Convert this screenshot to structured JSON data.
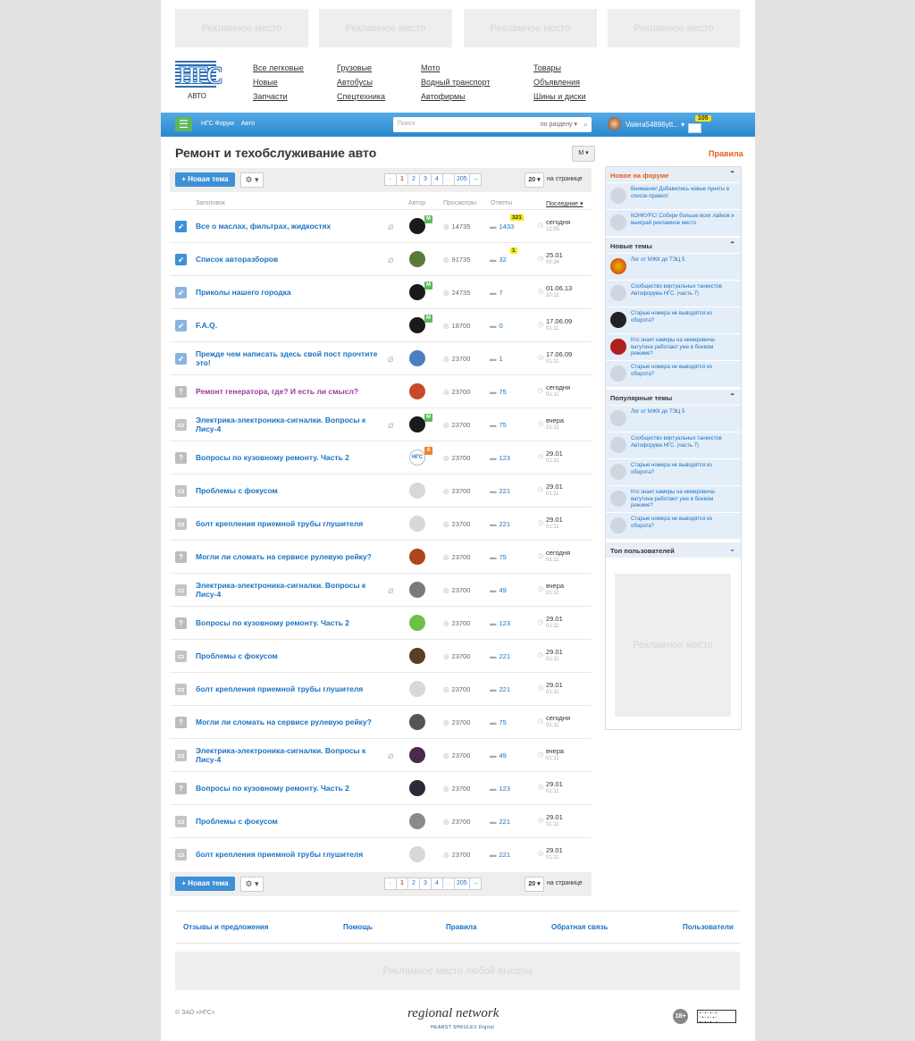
{
  "ads": {
    "top": [
      "Рекламное место",
      "Рекламное место",
      "Рекламное место",
      "Рекламное место"
    ],
    "side": "Рекламное место",
    "bottom": "Рекламное место любой высоты"
  },
  "logo": {
    "mark": "НГС",
    "sub": "АВТО"
  },
  "nav": [
    [
      "Все легковые",
      "Новые",
      "Запчасти"
    ],
    [
      "Грузовые",
      "Автобусы",
      "Спецтехника"
    ],
    [
      "Мото",
      "Водный транспорт",
      "Автофирмы"
    ],
    [
      "Товары",
      "Объявления",
      "Шины и диски"
    ]
  ],
  "bar": {
    "menu_icon": "menu-icon",
    "crumbs": [
      "НГС.Форум",
      "Авто"
    ],
    "search_placeholder": "Поиск",
    "search_scope": "по разделу ▾",
    "user": "Valera54896ytt... ▾",
    "mail_count": "105"
  },
  "page": {
    "title": "Ремонт и техобслуживание авто",
    "mode": "M ▾",
    "rules": "Правила"
  },
  "toolbar": {
    "new_topic": "+ Новая тема",
    "gear": "⚙ ▾",
    "pages": [
      "←",
      "1",
      "2",
      "3",
      "4",
      "...",
      "205",
      "→"
    ],
    "per_page": "20 ▾",
    "per_page_label": "на странице"
  },
  "columns": {
    "title": "Заголовок",
    "author": "Автор",
    "views": "Просмотры",
    "answers": "Ответы",
    "last": "Последние ▾"
  },
  "topics": [
    {
      "type": "pin",
      "title": "Все о маслах, фильтрах, жидкостях",
      "clip": true,
      "badge": "M",
      "badge_color": "#5cb85c",
      "avatar": "#1a1a1a",
      "views": "14735",
      "answers": "1433",
      "new": "321",
      "date": "сегодня",
      "time": "12:55"
    },
    {
      "type": "pin",
      "title": "Список авторазборов",
      "clip": true,
      "badge": "",
      "avatar": "#5b7a3a",
      "views": "91735",
      "answers": "32",
      "new": "1",
      "date": "25.01",
      "time": "00:34"
    },
    {
      "type": "pinlock",
      "title": "Приколы нашего городка",
      "clip": false,
      "badge": "M",
      "badge_color": "#5cb85c",
      "avatar": "#1a1a1a",
      "views": "24735",
      "answers": "7",
      "new": "",
      "date": "01.06.13",
      "time": "20:11"
    },
    {
      "type": "pinlock",
      "title": "F.A.Q.",
      "clip": false,
      "badge": "M",
      "badge_color": "#5cb85c",
      "avatar": "#1a1a1a",
      "views": "18700",
      "answers": "0",
      "new": "",
      "date": "17.06.09",
      "time": "01:11"
    },
    {
      "type": "pinlock",
      "title": "Прежде чем написать здесь свой пост прочтите это!",
      "clip": true,
      "badge": "",
      "avatar": "#4a80c0",
      "views": "23700",
      "answers": "1",
      "new": "",
      "date": "17.06.09",
      "time": "01:11"
    },
    {
      "type": "q",
      "title": "Ремонт генератора, где? И есть ли смысл?",
      "visited": true,
      "clip": false,
      "badge": "",
      "avatar": "#c94a2a",
      "views": "23700",
      "answers": "75",
      "new": "",
      "date": "сегодня",
      "time": "01:11"
    },
    {
      "type": "book",
      "title": "Электрика-электроника-сигналки. Вопросы к Лису-4",
      "clip": true,
      "badge": "M",
      "badge_color": "#5cb85c",
      "avatar": "#1a1a1a",
      "views": "23700",
      "answers": "75",
      "new": "",
      "date": "вчера",
      "time": "01:11"
    },
    {
      "type": "q",
      "title": "Вопросы по кузовному ремонту. Часть 2",
      "clip": false,
      "badge": "A",
      "badge_color": "#f0832a",
      "avatar": "#ffffff",
      "avatar_text": "НГС",
      "views": "23700",
      "answers": "123",
      "new": "",
      "date": "29.01",
      "time": "01:11"
    },
    {
      "type": "book",
      "title": "Проблемы с фокусом",
      "clip": false,
      "badge": "",
      "avatar": "#d8d8d8",
      "views": "23700",
      "answers": "221",
      "new": "",
      "date": "29.01",
      "time": "01:11"
    },
    {
      "type": "book",
      "title": "болт крепления приемной трубы глушителя",
      "clip": false,
      "badge": "",
      "avatar": "#d8d8d8",
      "views": "23700",
      "answers": "221",
      "new": "",
      "date": "29.01",
      "time": "01:11"
    },
    {
      "type": "q",
      "title": "Могли ли сломать на сервисе рулевую рейку?",
      "clip": false,
      "badge": "",
      "avatar": "#b0441a",
      "views": "23700",
      "answers": "75",
      "new": "",
      "date": "сегодня",
      "time": "01:11"
    },
    {
      "type": "book",
      "title": "Электрика-электроника-сигналки. Вопросы к Лису-4",
      "clip": true,
      "badge": "",
      "avatar": "#7a7a7a",
      "views": "23700",
      "answers": "49",
      "new": "",
      "date": "вчера",
      "time": "01:11"
    },
    {
      "type": "q",
      "title": "Вопросы по кузовному ремонту. Часть 2",
      "clip": false,
      "badge": "",
      "avatar": "#6cc04a",
      "views": "23700",
      "answers": "123",
      "new": "",
      "date": "29.01",
      "time": "01:11"
    },
    {
      "type": "book",
      "title": "Проблемы с фокусом",
      "clip": false,
      "badge": "",
      "avatar": "#5a4020",
      "views": "23700",
      "answers": "221",
      "new": "",
      "date": "29.01",
      "time": "01:11"
    },
    {
      "type": "book",
      "title": "болт крепления приемной трубы глушителя",
      "clip": false,
      "badge": "",
      "avatar": "#d8d8d8",
      "views": "23700",
      "answers": "221",
      "new": "",
      "date": "29.01",
      "time": "01:11"
    },
    {
      "type": "q",
      "title": "Могли ли сломать на сервисе рулевую рейку?",
      "clip": false,
      "badge": "",
      "avatar": "#555555",
      "views": "23700",
      "answers": "75",
      "new": "",
      "date": "сегодня",
      "time": "01:11"
    },
    {
      "type": "book",
      "title": "Электрика-электроника-сигналки. Вопросы к Лису-4",
      "clip": true,
      "badge": "",
      "avatar": "#4a2a4a",
      "views": "23700",
      "answers": "49",
      "new": "",
      "date": "вчера",
      "time": "01:11"
    },
    {
      "type": "q",
      "title": "Вопросы по кузовному ремонту. Часть 2",
      "clip": false,
      "badge": "",
      "avatar": "#2a2a3a",
      "views": "23700",
      "answers": "123",
      "new": "",
      "date": "29.01",
      "time": "01:11"
    },
    {
      "type": "book",
      "title": "Проблемы с фокусом",
      "clip": false,
      "badge": "",
      "avatar": "#8a8a8a",
      "views": "23700",
      "answers": "221",
      "new": "",
      "date": "29.01",
      "time": "01:11"
    },
    {
      "type": "book",
      "title": "болт крепления приемной трубы глушителя",
      "clip": false,
      "badge": "",
      "avatar": "#d8d8d8",
      "views": "23700",
      "answers": "221",
      "new": "",
      "date": "29.01",
      "time": "01:11"
    }
  ],
  "sidebar": {
    "new_title": "Новое на форуме",
    "new_items": [
      "Внимание! Добавились новые пункты в список правил!",
      "КОНКУРС! Собери больше всех лайков и выиграй рекламное место"
    ],
    "newtopics_title": "Новые темы",
    "newtopics": [
      "Лог от МЖК до ТЭЦ 5",
      "Сообщество виртуальных танкистов Автофорума НГС. (часть 7)",
      "Старые номера не выводятся из оборота?",
      "Кто знает камеры на немировича-ватутина работают уже в боевом режиме?",
      "Старые номера не выводятся из оборота?"
    ],
    "popular_title": "Популярные темы",
    "popular": [
      "Лог от МЖК до ТЭЦ 5",
      "Сообщество виртуальных танкистов Автофорума НГС. (часть 7)",
      "Старые номера не выводятся из оборота?",
      "Кто знает камеры на немировича-ватутина работают уже в боевом режиме?",
      "Старые номера не выводятся из оборота?"
    ],
    "top_users_title": "Топ пользователей"
  },
  "footer": {
    "links": [
      "Отзывы и предложения",
      "Помощь",
      "Правила",
      "Обратная связь",
      "Пользователи"
    ],
    "copyright": "© ЗАО «НГС»",
    "brand": "regional network",
    "brand_sub": "HEARST SHKULEV Digital",
    "age": "18+"
  },
  "colors": {
    "accent": "#3d8fd6",
    "link": "#1a73c4",
    "new_badge": "#f6e700",
    "rules": "#e35f17"
  }
}
